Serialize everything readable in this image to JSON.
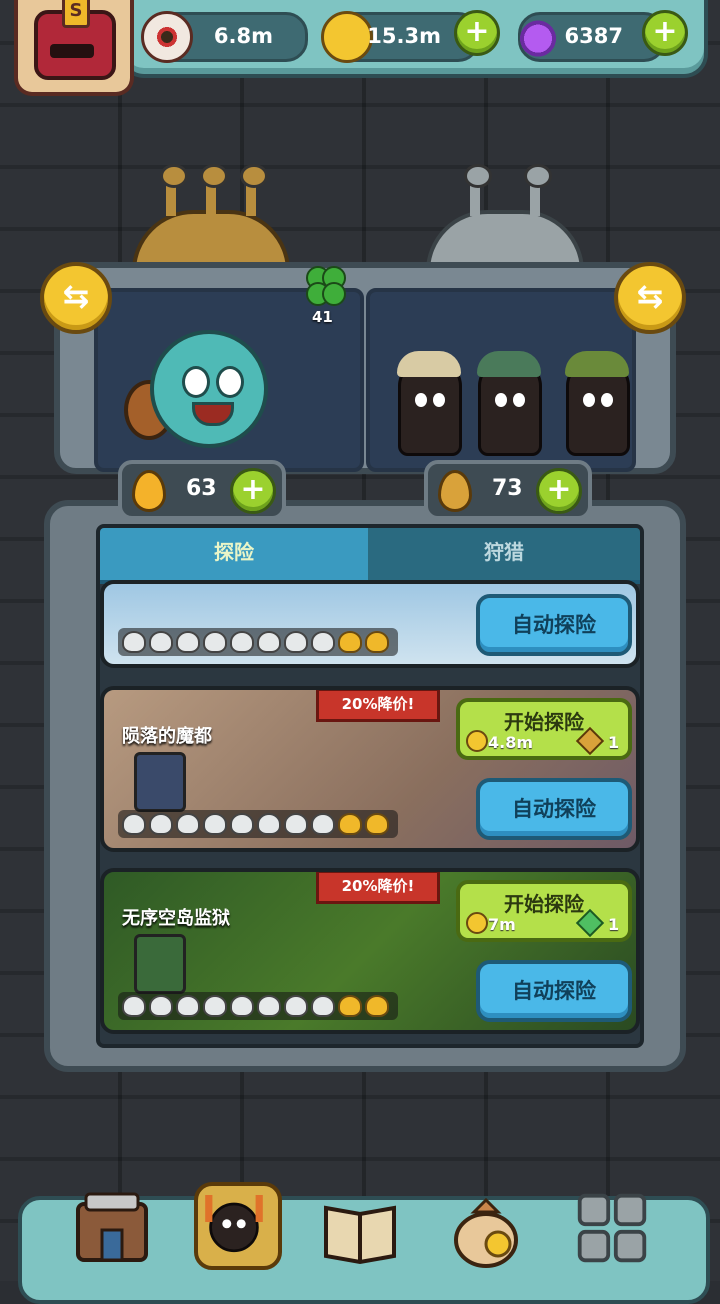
{
  "resources": {
    "eyes": "6.8m",
    "coins": "15.3m",
    "potions": "6387"
  },
  "avatar_badge": "S",
  "clover_count": "41",
  "energy": {
    "left": "63",
    "right": "73"
  },
  "tabs": {
    "explore": "探险",
    "hunt": "狩猎"
  },
  "stages": [
    {
      "name": "",
      "auto_label": "自动探险",
      "skulls_white": 8,
      "skulls_gold": 2
    },
    {
      "name": "陨落的魔都",
      "discount": "20%降价!",
      "start_label": "开始探险",
      "cost": "4.8m",
      "gem_qty": "1",
      "auto_label": "自动探险",
      "skulls_white": 8,
      "skulls_gold": 2,
      "theme_color": "#b79a80"
    },
    {
      "name": "无序空岛监狱",
      "discount": "20%降价!",
      "start_label": "开始探险",
      "cost": "7m",
      "gem_qty": "1",
      "auto_label": "自动探险",
      "skulls_white": 8,
      "skulls_gold": 2,
      "theme_color": "#3d6a2a"
    }
  ],
  "colors": {
    "accent_green": "#9bd12e",
    "button_blue": "#4ab8e8",
    "discount_red": "#c8352a",
    "teal_frame": "#7fc4c2"
  },
  "nav_icons": [
    "shop-icon",
    "monster-icon",
    "book-icon",
    "coin-bag-icon",
    "grid-menu-icon"
  ]
}
